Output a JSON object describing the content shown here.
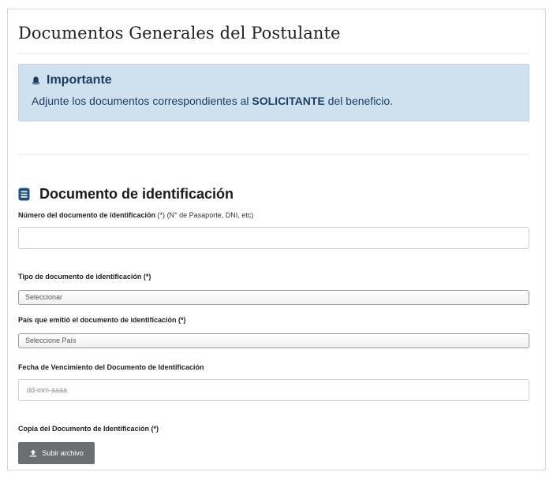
{
  "page": {
    "title": "Documentos Generales del Postulante"
  },
  "alert": {
    "title": "Importante",
    "text_prefix": "Adjunte los documentos correspondientes al ",
    "text_bold": "SOLICITANTE",
    "text_suffix": " del beneficio.",
    "icon": "bell-icon",
    "background": "#cfe0ef",
    "text_color": "#1b3d5f"
  },
  "section": {
    "title": "Documento de identificación",
    "icon": "document-icon",
    "icon_color": "#1f4f80"
  },
  "fields": {
    "doc_number": {
      "label": "Número del documento de identificación",
      "required": "(*)",
      "hint": "(N° de Pasaporte, DNI, etc)",
      "value": ""
    },
    "doc_type": {
      "label": "Tipo de documento de identificación (*)",
      "selected": "Seleccionar"
    },
    "country": {
      "label": "País que emitió el documento de identificación (*)",
      "selected": "Seleccione País"
    },
    "expiry": {
      "label": "Fecha de Vencimiento del Documento de Identificación",
      "placeholder": "dd-mm-aaaa"
    },
    "copy": {
      "label": "Copia del Documento de Identificación (*)",
      "button": "Subir archivo",
      "button_icon": "upload-icon",
      "button_color": "#6b6f74"
    }
  }
}
